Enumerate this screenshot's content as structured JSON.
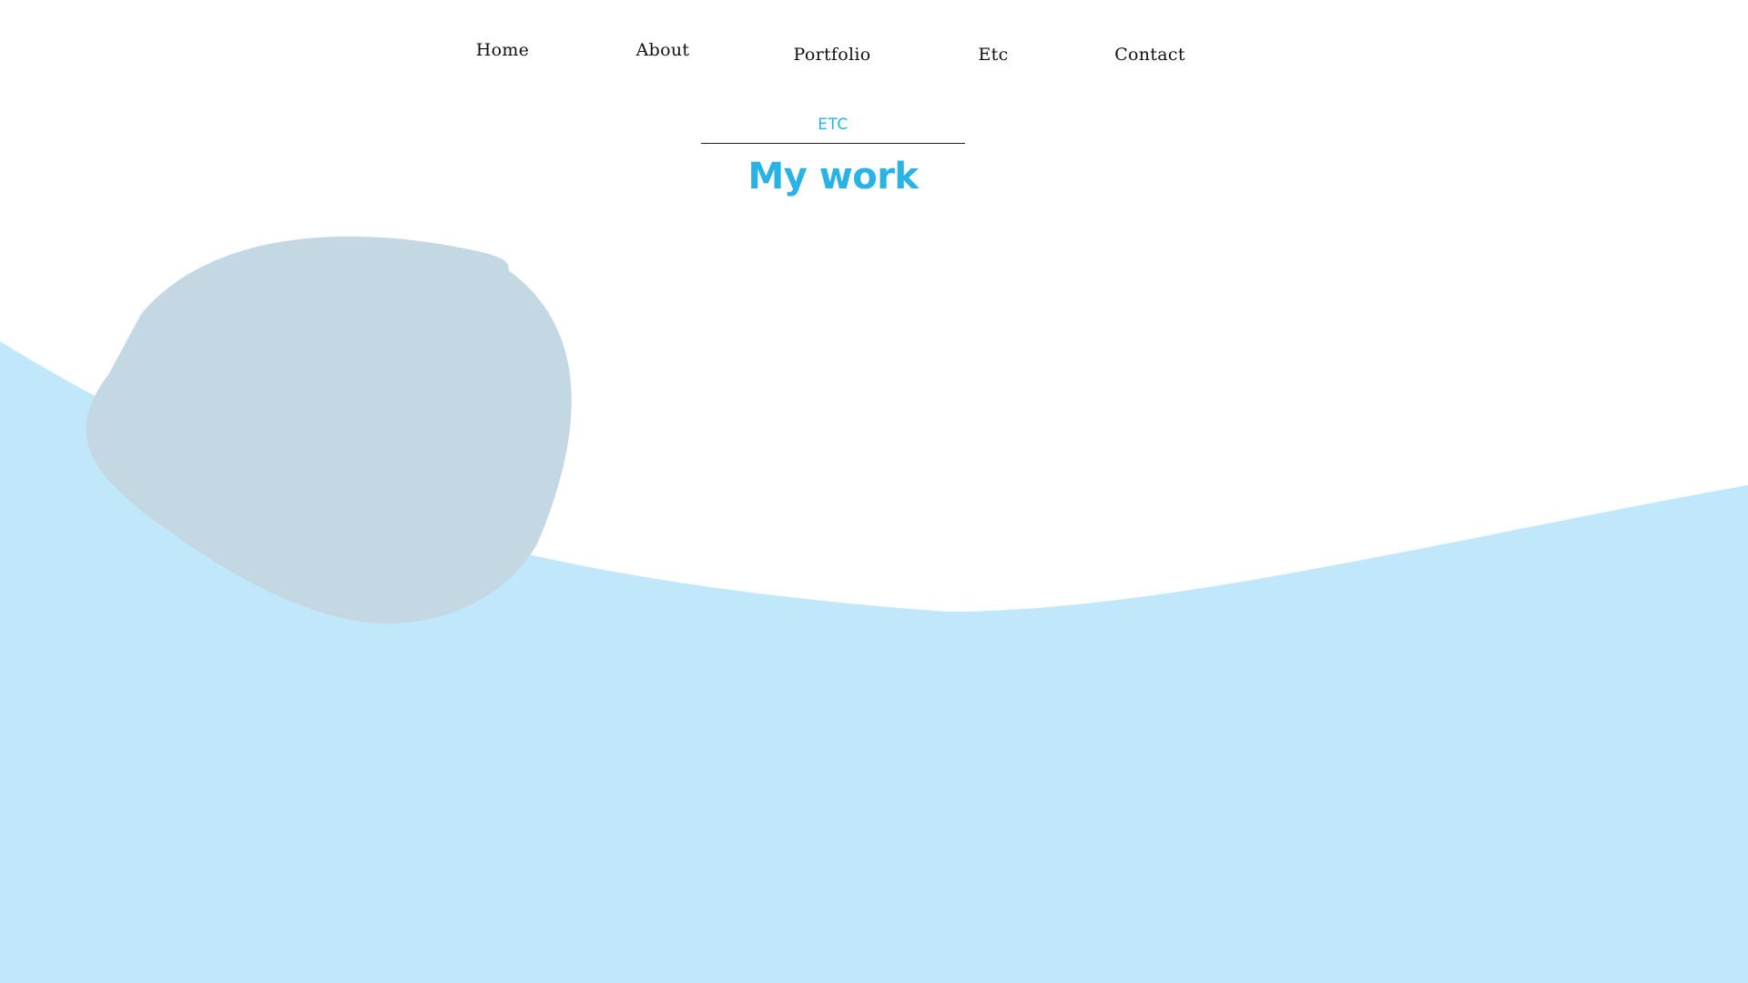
{
  "nav": {
    "items": [
      {
        "label": "Home"
      },
      {
        "label": "About"
      },
      {
        "label": "Portfolio"
      },
      {
        "label": "Etc"
      },
      {
        "label": "Contact"
      }
    ]
  },
  "section": {
    "eyebrow": "ETC",
    "title": "My work"
  },
  "colors": {
    "accent": "#29b2e5",
    "wave": "#c0e8fa",
    "blob": "#c4d8e4",
    "text": "#111111",
    "background": "#ffffff"
  }
}
